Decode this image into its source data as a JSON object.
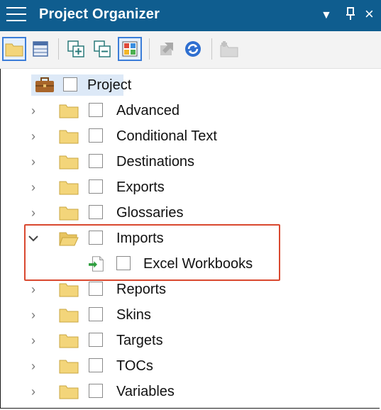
{
  "panel": {
    "title": "Project Organizer",
    "menu_icon": "hamburger-menu-icon",
    "dropdown_glyph": "▼",
    "pin_glyph": "ꟸ",
    "close_glyph": "×"
  },
  "toolbar": {
    "buttons": [
      {
        "icon": "folder-view-icon",
        "selected": true
      },
      {
        "icon": "grid-view-icon",
        "selected": false
      },
      {
        "icon": "expand-all-icon",
        "selected": false
      },
      {
        "icon": "collapse-all-icon",
        "selected": false
      },
      {
        "icon": "color-tiles-icon",
        "selected": true
      },
      {
        "icon": "import-arrow-icon",
        "selected": false
      },
      {
        "icon": "refresh-icon",
        "selected": false
      },
      {
        "icon": "new-folder-icon",
        "selected": false
      }
    ]
  },
  "tree": {
    "root": {
      "label": "Project",
      "icon": "briefcase-icon"
    },
    "items": [
      {
        "label": "Advanced",
        "expanded": false
      },
      {
        "label": "Conditional Text",
        "expanded": false
      },
      {
        "label": "Destinations",
        "expanded": false
      },
      {
        "label": "Exports",
        "expanded": false
      },
      {
        "label": "Glossaries",
        "expanded": false
      },
      {
        "label": "Imports",
        "expanded": true,
        "children": [
          {
            "label": "Excel Workbooks",
            "icon": "import-file-icon"
          }
        ]
      },
      {
        "label": "Reports",
        "expanded": false
      },
      {
        "label": "Skins",
        "expanded": false
      },
      {
        "label": "Targets",
        "expanded": false
      },
      {
        "label": "TOCs",
        "expanded": false
      },
      {
        "label": "Variables",
        "expanded": false
      }
    ]
  },
  "colors": {
    "titlebar": "#0f5d8f",
    "highlight_box": "#d9482f",
    "folder_fill": "#f3d57a"
  }
}
